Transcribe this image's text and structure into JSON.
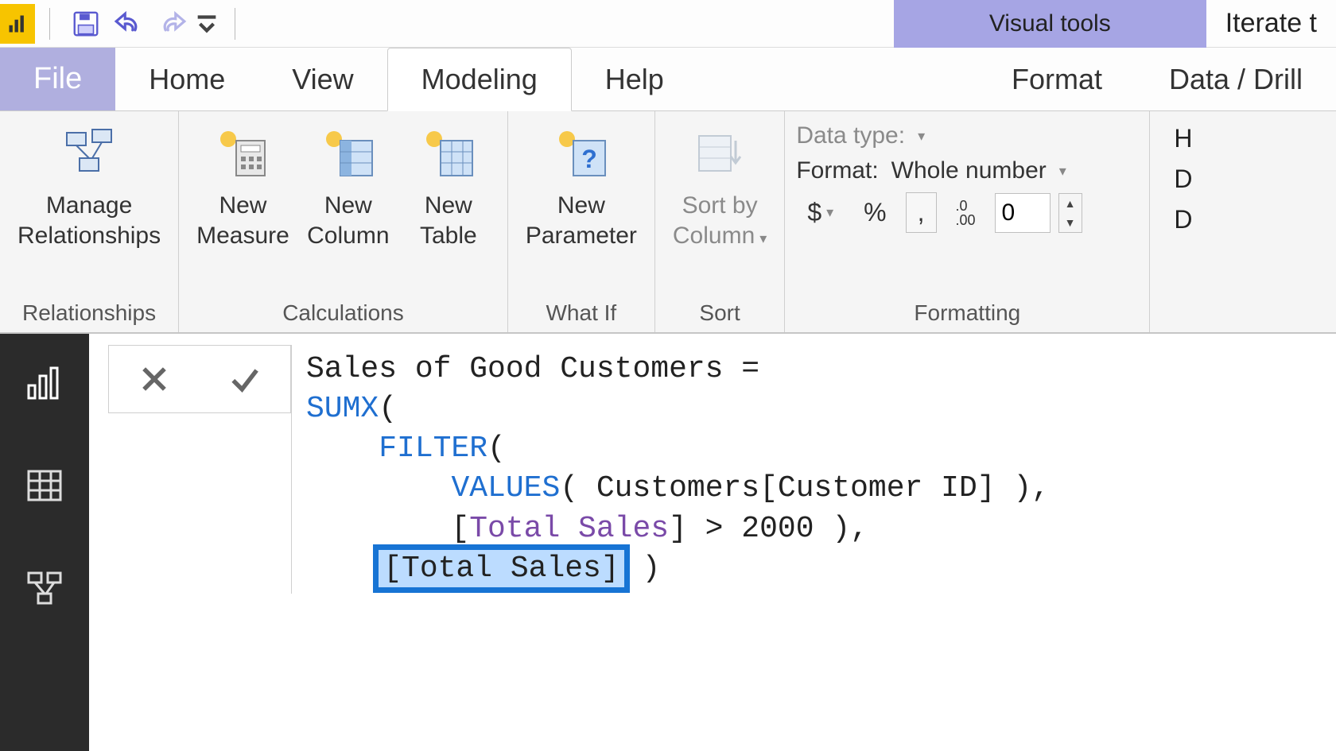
{
  "titlebar": {
    "context_tab": "Visual tools",
    "app_title_fragment": "Iterate t"
  },
  "tabs": {
    "file": "File",
    "home": "Home",
    "view": "View",
    "modeling": "Modeling",
    "help": "Help",
    "format": "Format",
    "data_drill": "Data / Drill"
  },
  "ribbon": {
    "relationships": {
      "manage": "Manage\nRelationships",
      "caption": "Relationships"
    },
    "calculations": {
      "new_measure": "New\nMeasure",
      "new_column": "New\nColumn",
      "new_table": "New\nTable",
      "caption": "Calculations"
    },
    "whatif": {
      "new_parameter": "New\nParameter",
      "caption": "What If"
    },
    "sort": {
      "sort_by_column": "Sort by\nColumn",
      "caption": "Sort"
    },
    "formatting": {
      "data_type_label": "Data type:",
      "format_label": "Format:",
      "format_value": "Whole number",
      "currency": "$",
      "percent": "%",
      "comma": ",",
      "decimals_icon": ".0\n.00",
      "decimals_value": "0",
      "caption": "Formatting"
    },
    "right_cut": {
      "line1": "H",
      "line2": "D",
      "line3": "D"
    }
  },
  "formula": {
    "line1_name": "Sales of Good Customers",
    "equals": " = ",
    "fn_sumx": "SUMX",
    "fn_filter": "FILTER",
    "fn_values": "VALUES",
    "tbl_col": "Customers[Customer ID]",
    "meas_total_sales": "Total Sales",
    "threshold": "2000",
    "selected": "[Total Sales]"
  },
  "background_text": "Iter"
}
